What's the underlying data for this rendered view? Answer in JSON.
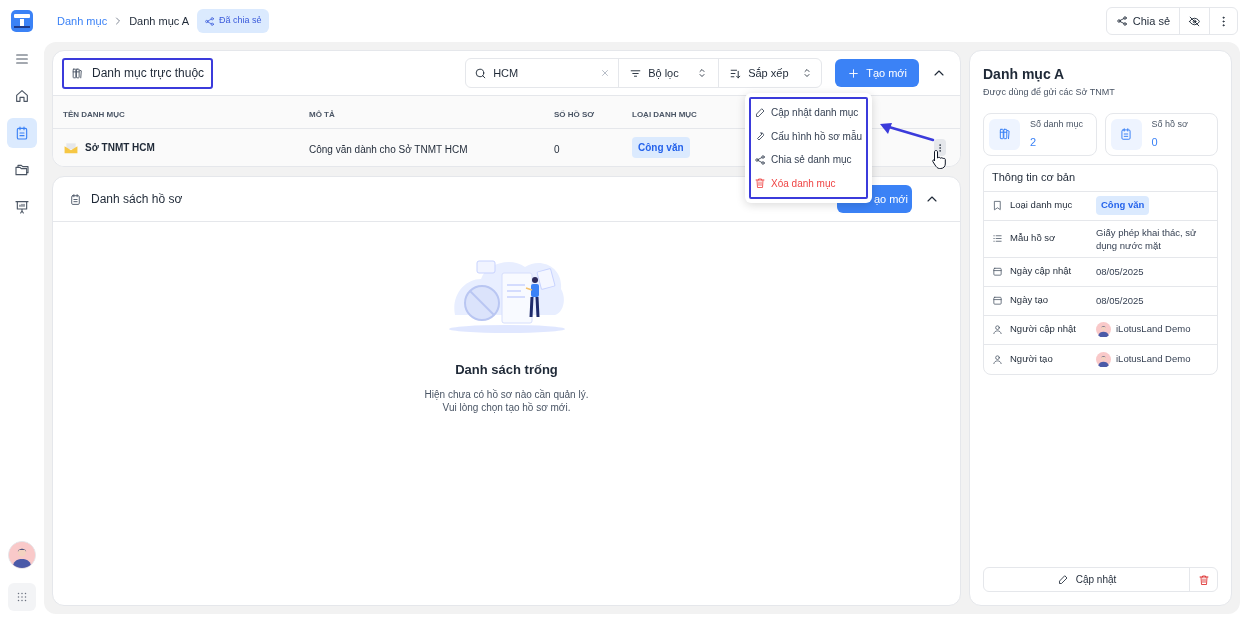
{
  "breadcrumb": [
    {
      "label": "Danh mục",
      "current": false
    },
    {
      "label": "Danh mục A",
      "current": true
    }
  ],
  "shared_badge": "Đã chia sẻ",
  "top_actions": {
    "share": "Chia sẻ"
  },
  "sidebar": {
    "items": [
      {
        "kind": "menu",
        "selected": false
      },
      {
        "kind": "home",
        "selected": false
      },
      {
        "kind": "notepad",
        "selected": true
      },
      {
        "kind": "folders",
        "selected": false
      },
      {
        "kind": "board",
        "selected": false
      }
    ]
  },
  "subcategories": {
    "title": "Danh mục trực thuộc",
    "highlighted": true,
    "search": {
      "value": "HCM"
    },
    "filter": "Bộ lọc",
    "sort": "Sắp xếp",
    "create": "Tạo mới",
    "columns": [
      "TÊN DANH MỤC",
      "MÔ TẢ",
      "SỐ HỒ SƠ",
      "LOẠI DANH MỤC"
    ],
    "rows": [
      {
        "name": "Sở TNMT HCM",
        "description": "Công văn dành cho Sở TNMT HCM",
        "count": "0",
        "type": "Công văn"
      }
    ]
  },
  "context_menu": {
    "highlighted": true,
    "items": [
      {
        "kind": "edit",
        "label": "Cập nhật danh mục",
        "danger": false
      },
      {
        "kind": "wrench",
        "label": "Cấu hình hồ sơ mẫu",
        "danger": false
      },
      {
        "kind": "share",
        "label": "Chia sẻ danh mục",
        "danger": false
      },
      {
        "kind": "trash",
        "label": "Xóa danh mục",
        "danger": true
      }
    ]
  },
  "records": {
    "title": "Danh sách hồ sơ",
    "create_visible": "ạo mới",
    "empty": {
      "title": "Danh sách trống",
      "message": "Hiện chưa có hồ sơ nào cần quản lý.\nVui lòng chọn tạo hồ sơ mới."
    }
  },
  "detail": {
    "title": "Danh mục A",
    "subtitle": "Được dùng để gửi các Sở TNMT",
    "stats": [
      {
        "kind": "categories",
        "label": "Số danh mục",
        "value": "2"
      },
      {
        "kind": "records",
        "label": "Số hồ sơ",
        "value": "0"
      }
    ],
    "info": {
      "title": "Thông tin cơ bản",
      "rows": [
        {
          "kind": "tag",
          "label": "Loại danh mục",
          "value": "Công văn"
        },
        {
          "kind": "text",
          "label": "Mẫu hồ sơ",
          "value": "Giấy phép khai thác, sử dụng nước mặt"
        },
        {
          "kind": "text",
          "label": "Ngày cập nhật",
          "value": "08/05/2025"
        },
        {
          "kind": "text",
          "label": "Ngày tạo",
          "value": "08/05/2025"
        },
        {
          "kind": "user",
          "label": "Người cập nhật",
          "value": "iLotusLand Demo"
        },
        {
          "kind": "user",
          "label": "Người tạo",
          "value": "iLotusLand Demo"
        }
      ]
    },
    "update_button": "Cập nhật"
  }
}
